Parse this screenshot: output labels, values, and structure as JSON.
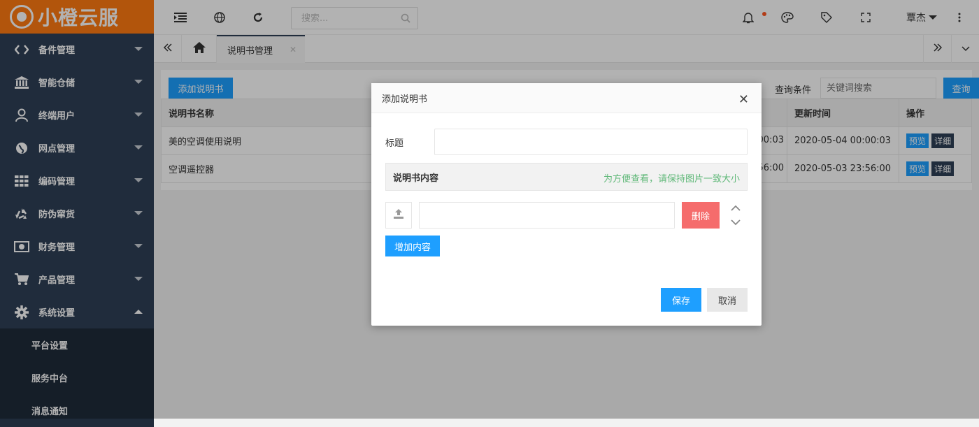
{
  "brand": {
    "name": "小橙云服",
    "color": "#ff7a12"
  },
  "sidebar": {
    "items": [
      {
        "label": "备件管理",
        "icon": "code-icon"
      },
      {
        "label": "智能仓储",
        "icon": "bank-icon"
      },
      {
        "label": "终端用户",
        "icon": "user-icon"
      },
      {
        "label": "网点管理",
        "icon": "globe-icon"
      },
      {
        "label": "编码管理",
        "icon": "grid-icon"
      },
      {
        "label": "防伪窜货",
        "icon": "recycle-icon"
      },
      {
        "label": "财务管理",
        "icon": "money-icon"
      },
      {
        "label": "产品管理",
        "icon": "cart-icon"
      },
      {
        "label": "系统设置",
        "icon": "gear-icon",
        "expanded": true
      }
    ],
    "sub_items": [
      {
        "label": "平台设置"
      },
      {
        "label": "服务中台"
      },
      {
        "label": "消息通知"
      }
    ]
  },
  "header": {
    "search_placeholder": "搜索...",
    "user": "覃杰"
  },
  "tabs": {
    "active": "说明书管理"
  },
  "toolbar": {
    "add_label": "添加说明书",
    "query_label": "查询条件",
    "query_placeholder": "关键词搜索",
    "query_button": "查询"
  },
  "table": {
    "columns": [
      "说明书名称",
      "更新时间",
      "操作"
    ],
    "rows": [
      {
        "name": "美的空调使用说明",
        "hidden_time": "00:03",
        "updated": "2020-05-04 00:00:03",
        "preview": "预览",
        "detail": "详细"
      },
      {
        "name": "空调遥控器",
        "hidden_time": "56:00",
        "updated": "2020-05-03 23:56:00",
        "preview": "预览",
        "detail": "详细"
      }
    ]
  },
  "modal": {
    "title": "添加说明书",
    "field_label": "标题",
    "section_title": "说明书内容",
    "section_tip": "为方便查看，请保持图片一致大小",
    "delete_label": "删除",
    "add_content_label": "增加内容",
    "save_label": "保存",
    "cancel_label": "取消"
  },
  "colors": {
    "sidebar": "#2f4056",
    "primary": "#1e9fff",
    "danger": "#f56c6c",
    "tip": "#5fb878"
  }
}
